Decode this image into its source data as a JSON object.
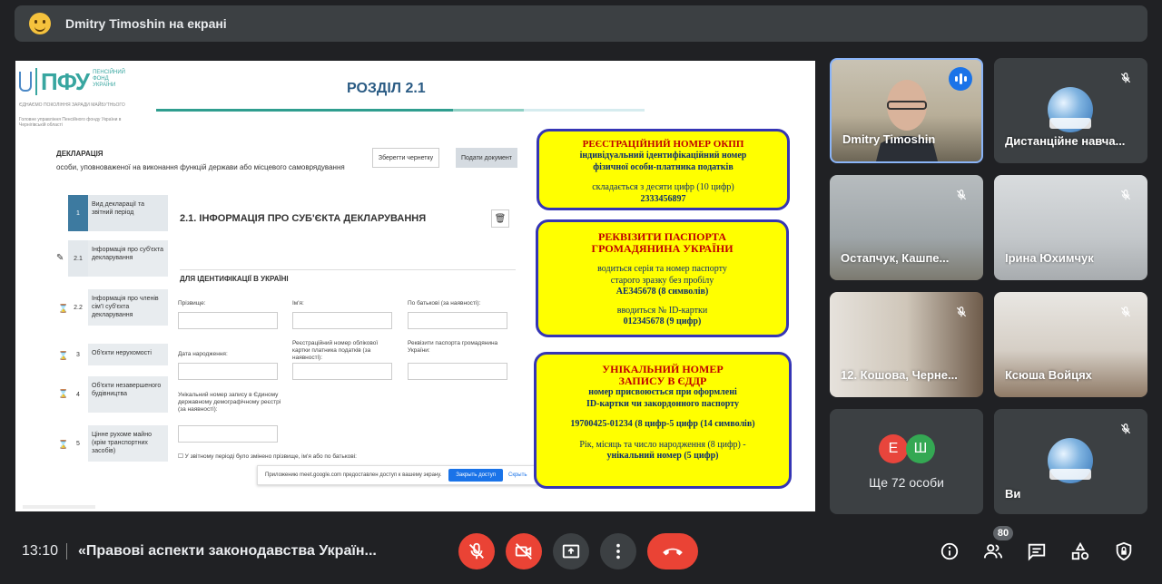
{
  "banner": {
    "text": "Dmitry Timoshin на екрані"
  },
  "slide": {
    "logo_text": "ПФУ",
    "logo_small": "ПЕНСІЙНИЙ ФОНД УКРАЇНИ",
    "logo_tagline": "ЄДНАЄМО ПОКОЛІННЯ ЗАРАДИ МАЙБУТНЬОГО",
    "logo_dept": "Головне управління Пенсійного фонду України в Чернігівській області",
    "heading": "РОЗДІЛ 2.1",
    "declaration_title": "ДЕКЛАРАЦІЯ",
    "declaration_sub": "особи, уповноваженої на виконання функцій держави або місцевого самоврядування",
    "save_draft": "Зберегти чернетку",
    "submit_doc": "Подати документ",
    "steps": [
      {
        "num": "1",
        "label": "Вид декларації та звітний період"
      },
      {
        "num": "2.1",
        "label": "Інформація про суб'єкта декларування"
      },
      {
        "num": "2.2",
        "label": "Інформація про членів сім'ї суб'єкта декларування"
      },
      {
        "num": "3",
        "label": "Об'єкти нерухомості"
      },
      {
        "num": "4",
        "label": "Об'єкти незавершеного будівництва"
      },
      {
        "num": "5",
        "label": "Цінне рухоме майно (крім транспортних засобів)"
      }
    ],
    "section_title": "2.1.  ІНФОРМАЦІЯ ПРО СУБ'ЄКТА ДЕКЛАРУВАННЯ",
    "subsection": "ДЛЯ ІДЕНТИФІКАЦІЇ В УКРАЇНІ",
    "fields": {
      "surname": "Прізвище:",
      "name": "Ім'я:",
      "patronymic": "По батькові (за наявності):",
      "birth": "Дата народження:",
      "tax_id": "Реєстраційний номер облікової картки платника податків (за наявності):",
      "passport": "Реквізити паспорта громадянина України:",
      "unzr": "Унікальний номер запису в Єдиному державному демографічному реєстрі (за наявності):"
    },
    "checkbox_text": "У звітному періоді було змінено прізвище, ім'я або по батькові:",
    "notification": "Приложению meet.google.com предоставлен доступ к вашему экрану.",
    "notification_stop": "Закрыть доступ",
    "notification_hide": "Скрыть",
    "box1": {
      "title": "РЕЄСТРАЦІЙНИЙ НОМЕР ОКПП",
      "l1": "індивідуальний ідентифікаційний номер",
      "l2": "фізичної особи-платника податків",
      "l3": "складається з десяти цифр (10 цифр)",
      "l4": "2333456897"
    },
    "box2": {
      "title1": "РЕКВІЗИТИ ПАСПОРТА",
      "title2": "ГРОМАДЯНИНА УКРАЇНИ",
      "l1": "водиться серія та номер паспорту",
      "l2": "старого зразку без пробілу",
      "l3": "АЕ345678 (8 символів)",
      "l4": "вводиться № ID-картки",
      "l5": "012345678 (9 цифр)"
    },
    "box3": {
      "title1": "УНІКАЛЬНИЙ НОМЕР",
      "title2": "ЗАПИСУ В ЄДДР",
      "l1": "номер присвоюється при оформлені",
      "l2": "ID-картки чи закордонного паспорту",
      "l3": "19700425-01234 (8 цифр-5 цифр (14 символів)",
      "l4": "Рік, місяць та число народження (8 цифр) -",
      "l5": "унікальний номер (5 цифр)"
    }
  },
  "participants": [
    {
      "name": "Dmitry Timoshin"
    },
    {
      "name": "Дистанційне навча..."
    },
    {
      "name": "Остапчук, Кашпе..."
    },
    {
      "name": "Ірина Юхимчук"
    },
    {
      "name": "12. Кошова, Черне..."
    },
    {
      "name": "Ксюша Войцях"
    },
    {
      "name": "Ще 72 особи",
      "avatars": [
        "Е",
        "Ш"
      ]
    },
    {
      "name": "Ви"
    }
  ],
  "bottom": {
    "time": "13:10",
    "title": "«Правові аспекти законодавства Україн...",
    "people_count": "80"
  },
  "colors": {
    "avatar_e": "#e8453c",
    "avatar_sh": "#34a853",
    "danger": "#ea4335",
    "accent": "#1a73e8"
  }
}
